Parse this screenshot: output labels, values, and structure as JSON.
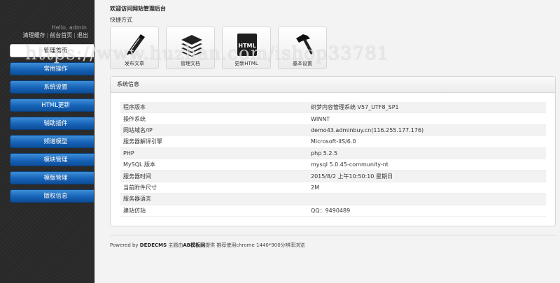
{
  "sidebar": {
    "greeting": "Hello, admin",
    "links": [
      "清理缓存",
      "前台首页",
      "退出"
    ],
    "separator": "|",
    "menu": [
      {
        "label": "管理首页",
        "active": true
      },
      {
        "label": "常用操作"
      },
      {
        "label": "系统设置"
      },
      {
        "label": "HTML更新"
      },
      {
        "label": "辅助插件"
      },
      {
        "label": "频道模型"
      },
      {
        "label": "模块管理"
      },
      {
        "label": "模版管理"
      },
      {
        "label": "版权信息"
      }
    ]
  },
  "main": {
    "welcome": "欢迎访问网站管理后台",
    "quick_title": "快捷方式",
    "quick_buttons": [
      {
        "label": "发布文章",
        "icon": "pencil-icon"
      },
      {
        "label": "管理文档",
        "icon": "stack-icon"
      },
      {
        "label": "更新HTML",
        "icon": "html-file-icon",
        "icon_text": "HTML"
      },
      {
        "label": "基本设置",
        "icon": "hammer-icon"
      }
    ],
    "panel_title": "系统信息",
    "info_rows": [
      {
        "key": "程序版本",
        "value": "织梦内容管理系统 V57_UTF8_SP1"
      },
      {
        "key": "操作系统",
        "value": "WINNT"
      },
      {
        "key": "网站域名/IP",
        "value": "demo43.adminbuy.cn(116.255.177.176)"
      },
      {
        "key": "服务器解译引擎",
        "value": "Microsoft-IIS/6.0"
      },
      {
        "key": "PHP",
        "value": "php 5.2.5"
      },
      {
        "key": "MySQL 版本",
        "value": "mysql 5.0.45-community-nt"
      },
      {
        "key": "服务器时间",
        "value": "2015/8/2 上午10:50:10 星期日"
      },
      {
        "key": "当前附件尺寸",
        "value": "2M"
      },
      {
        "key": "服务器语言",
        "value": ""
      },
      {
        "key": "建站仿站",
        "value": "QQ：9490489"
      }
    ]
  },
  "footer": {
    "prefix": "Powered by ",
    "brand": "DEDECMS",
    "middle": " 主题由",
    "theme": "AB模板网",
    "suffix": "提供 推荐使用chrome 1440*900分辨率浏览"
  },
  "watermark": "https://www.huzhan.com/ishop33781"
}
